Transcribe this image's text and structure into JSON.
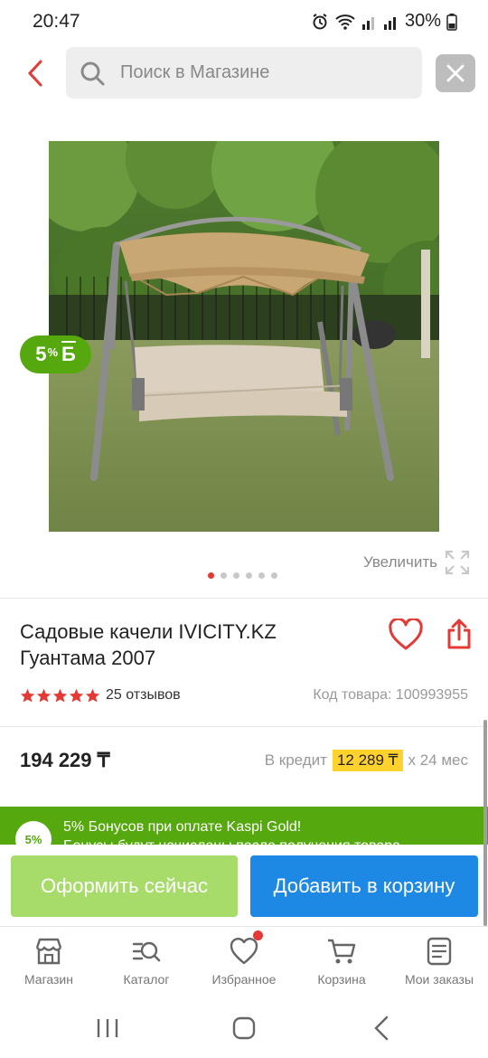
{
  "status_bar": {
    "time": "20:47",
    "battery": "30%"
  },
  "search": {
    "placeholder": "Поиск в Магазине"
  },
  "product": {
    "bonus_badge_value": "5",
    "bonus_badge_sup": "%",
    "bonus_badge_currency": "Б",
    "zoom_label": "Увеличить",
    "image_count": 6,
    "active_image": 1,
    "title": "Садовые качели IVICITY.KZ Гуантама 2007",
    "rating": 5,
    "reviews": "25 отзывов",
    "sku": "Код товара: 100993955",
    "price": "194 229 ₸",
    "credit_prefix": "В кредит",
    "credit_amount": "12 289 ₸",
    "credit_suffix": "х 24 мес"
  },
  "gold_banner": {
    "badge": "5%",
    "line1": "5% Бонусов при оплате Kaspi Gold!",
    "line2": "Бонусы будут начислены после получения товара"
  },
  "actions": {
    "checkout_label": "Оформить сейчас",
    "cart_label": "Добавить в корзину"
  },
  "tabs": [
    {
      "label": "Магазин",
      "icon": "store-icon"
    },
    {
      "label": "Каталог",
      "icon": "catalog-search-icon"
    },
    {
      "label": "Избранное",
      "icon": "heart-icon"
    },
    {
      "label": "Корзина",
      "icon": "cart-icon"
    },
    {
      "label": "Мои заказы",
      "icon": "orders-icon"
    }
  ],
  "colors": {
    "accent_red": "#e53935",
    "kaspi_green": "#55a80d",
    "checkout_green": "#a8dc6a",
    "cart_blue": "#1e88e5",
    "credit_yellow": "#ffd22e"
  }
}
